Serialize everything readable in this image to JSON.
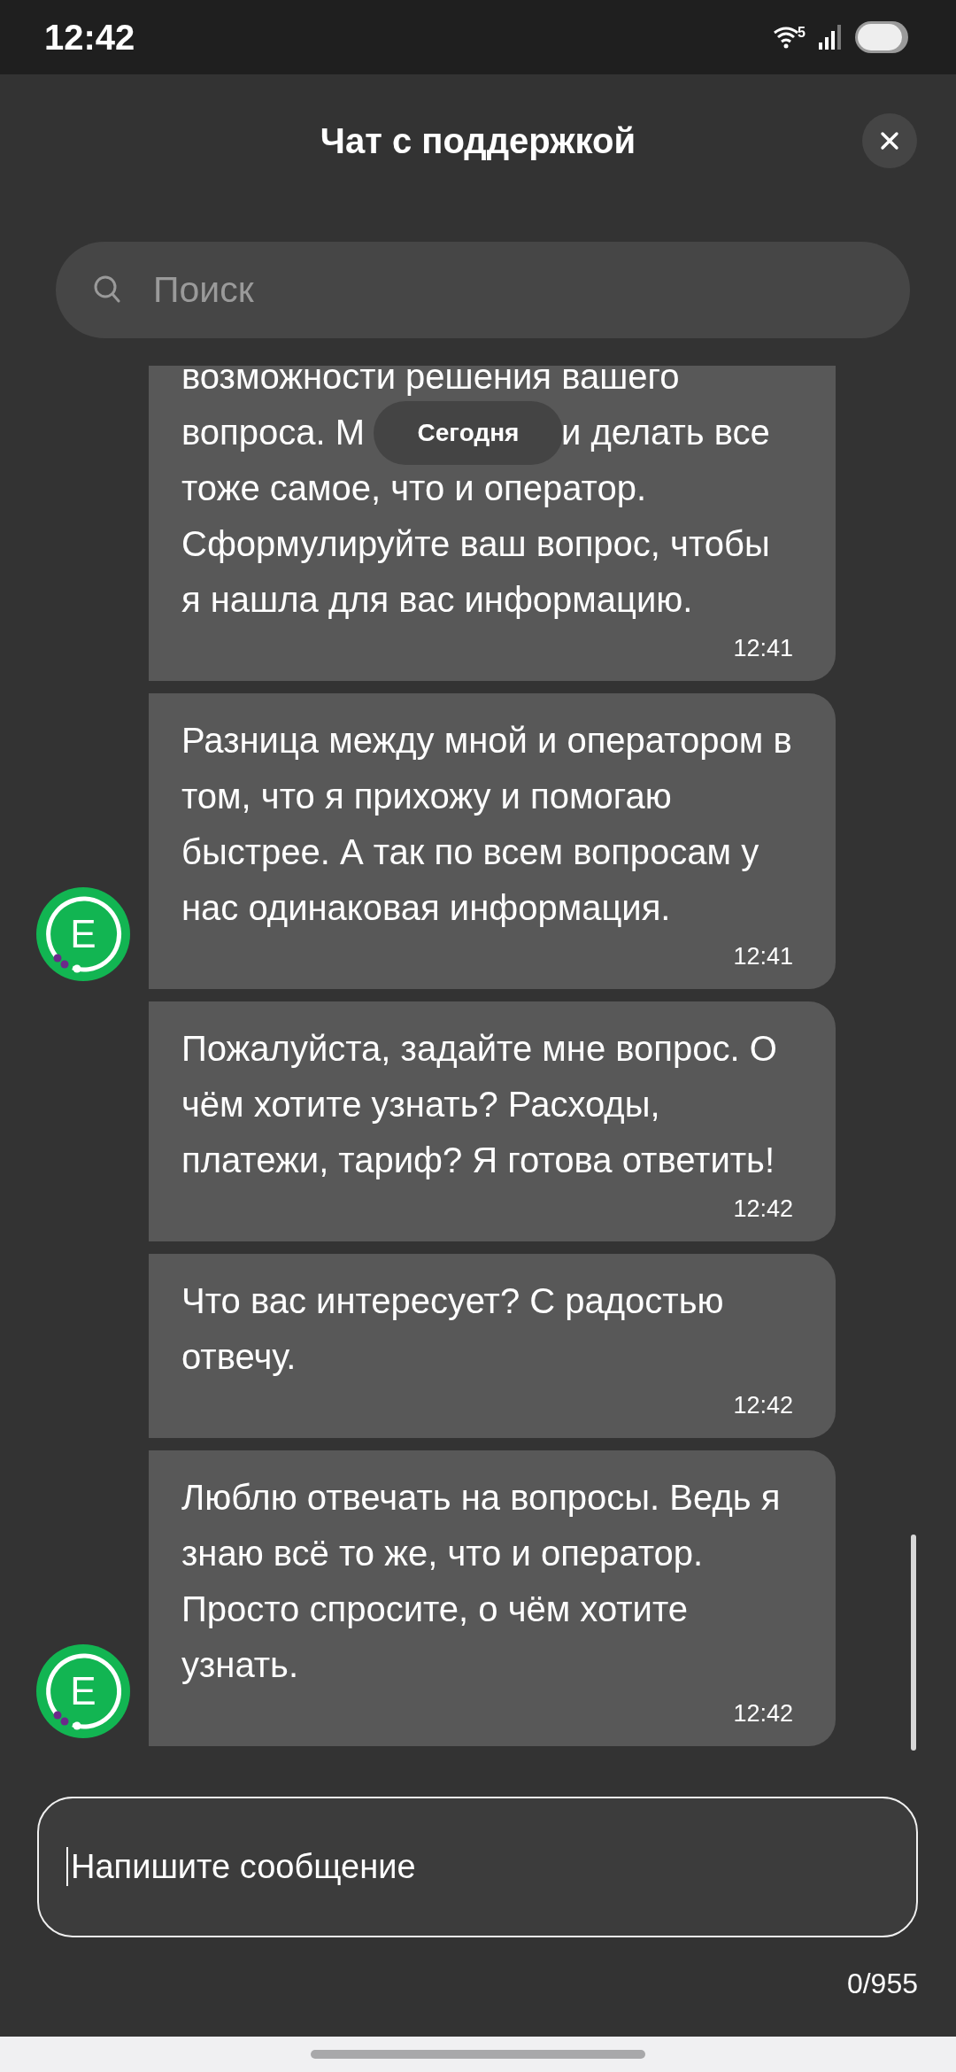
{
  "status_bar": {
    "time": "12:42",
    "wifi_label": "5"
  },
  "header": {
    "title": "Чат с поддержкой"
  },
  "search": {
    "placeholder": "Поиск"
  },
  "date_chip": "Сегодня",
  "messages": [
    {
      "lines": [
        [
          "возможности решения вашего"
        ],
        [
          "вопроса. М",
          "и делать все"
        ],
        [
          "тоже самое, что и оператор."
        ],
        [
          "Сформулируйте ваш вопрос, чтобы"
        ],
        [
          "я нашла для вас информацию."
        ]
      ],
      "time": "12:41"
    },
    {
      "text": "Разница между мной и оператором в том, что я прихожу и помогаю быстрее. А так по всем вопросам у нас одинаковая информация.",
      "time": "12:41",
      "avatar": "E"
    },
    {
      "text": "Пожалуйста, задайте мне вопрос. О чём хотите узнать? Расходы, платежи, тариф? Я готова ответить!",
      "time": "12:42"
    },
    {
      "text": "Что вас интересует? С радостью отвечу.",
      "time": "12:42"
    },
    {
      "text": "Люблю отвечать на вопросы. Ведь я знаю всё то же, что и оператор. Просто спросите, о чём хотите узнать.",
      "time": "12:42",
      "avatar": "E"
    }
  ],
  "composer": {
    "placeholder": "Напишите сообщение",
    "counter": "0/955"
  }
}
